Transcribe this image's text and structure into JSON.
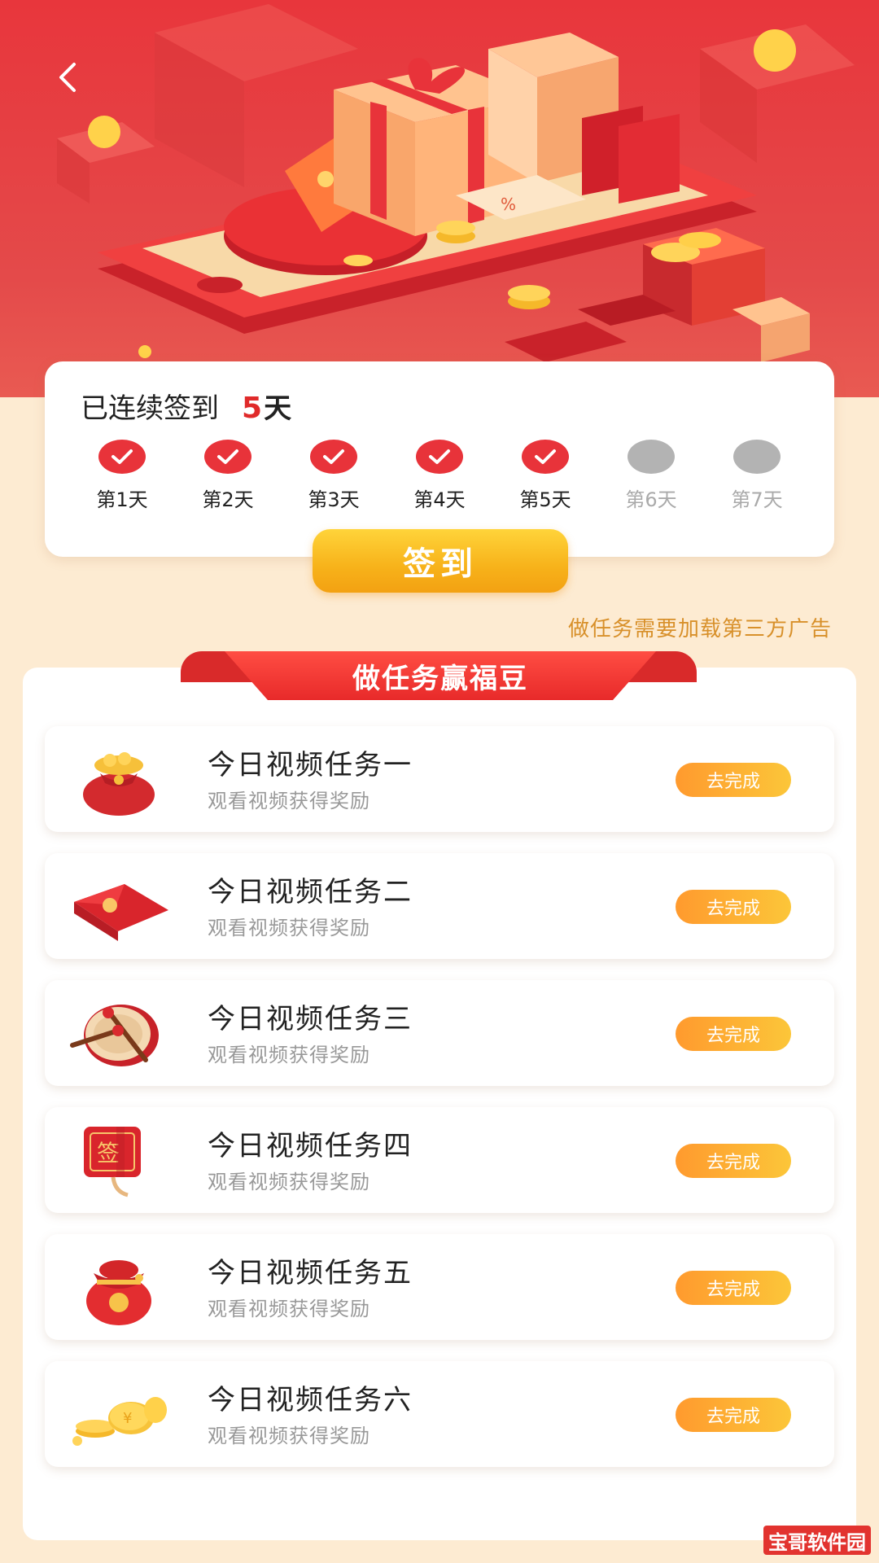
{
  "header": {
    "back_icon": "chevron-left-icon"
  },
  "checkin": {
    "prefix": "已连续签到",
    "count": "5",
    "unit": "天",
    "days": [
      {
        "label": "第1天",
        "done": true
      },
      {
        "label": "第2天",
        "done": true
      },
      {
        "label": "第3天",
        "done": true
      },
      {
        "label": "第4天",
        "done": true
      },
      {
        "label": "第5天",
        "done": true
      },
      {
        "label": "第6天",
        "done": false
      },
      {
        "label": "第7天",
        "done": false
      }
    ],
    "sign_button": "签到"
  },
  "ad_notice": "做任务需要加载第三方广告",
  "tasks_section": {
    "title": "做任务赢福豆",
    "items": [
      {
        "title": "今日视频任务一",
        "subtitle": "观看视频获得奖励",
        "button": "去完成",
        "icon": "money-bag-icon"
      },
      {
        "title": "今日视频任务二",
        "subtitle": "观看视频获得奖励",
        "button": "去完成",
        "icon": "red-envelope-icon"
      },
      {
        "title": "今日视频任务三",
        "subtitle": "观看视频获得奖励",
        "button": "去完成",
        "icon": "drum-icon"
      },
      {
        "title": "今日视频任务四",
        "subtitle": "观看视频获得奖励",
        "button": "去完成",
        "icon": "sign-card-icon"
      },
      {
        "title": "今日视频任务五",
        "subtitle": "观看视频获得奖励",
        "button": "去完成",
        "icon": "lucky-bag-icon"
      },
      {
        "title": "今日视频任务六",
        "subtitle": "观看视频获得奖励",
        "button": "去完成",
        "icon": "gold-coins-icon"
      }
    ]
  },
  "watermark": "宝哥软件园",
  "colors": {
    "primary_red": "#e8333a",
    "gold": "#f7b21a",
    "background": "#fdebd2"
  }
}
